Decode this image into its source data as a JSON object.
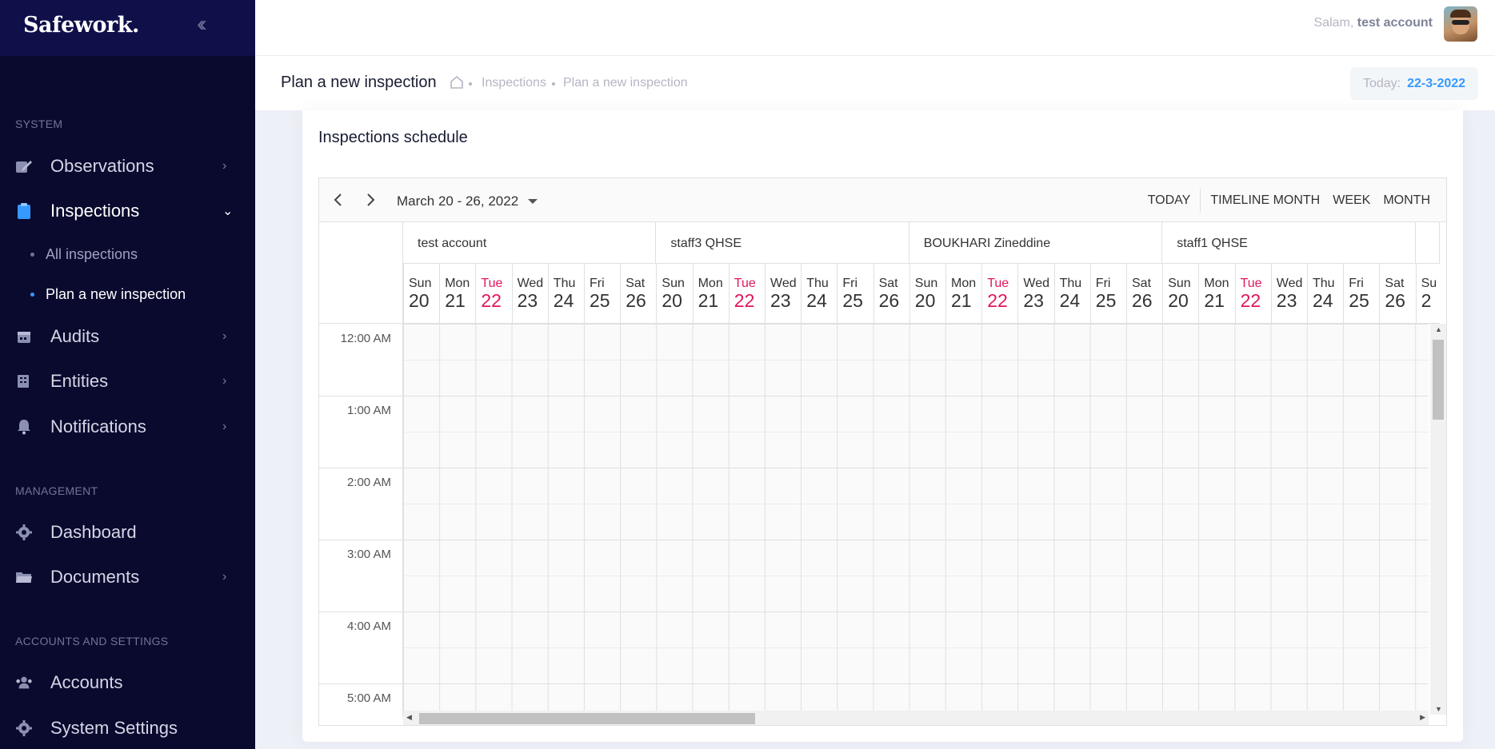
{
  "app": {
    "brand": "Safework.",
    "collapse_icon": "double-chevron-left-icon"
  },
  "sidebar": {
    "sections": [
      {
        "title": "SYSTEM"
      },
      {
        "title": "MANAGEMENT"
      },
      {
        "title": "ACCOUNTS AND SETTINGS"
      }
    ],
    "items": [
      {
        "label": "Observations",
        "icon": "edit-icon"
      },
      {
        "label": "Inspections",
        "icon": "clipboard-icon"
      },
      {
        "label": "Audits",
        "icon": "calendar-icon"
      },
      {
        "label": "Entities",
        "icon": "building-icon"
      },
      {
        "label": "Notifications",
        "icon": "bell-icon"
      },
      {
        "label": "Dashboard",
        "icon": "gear-icon"
      },
      {
        "label": "Documents",
        "icon": "folder-icon"
      },
      {
        "label": "Accounts",
        "icon": "users-icon"
      },
      {
        "label": "System Settings",
        "icon": "gear-icon"
      }
    ],
    "subitems": [
      {
        "label": "All inspections"
      },
      {
        "label": "Plan a new inspection"
      }
    ],
    "accent_color": "#3699ff"
  },
  "header": {
    "greeting": "Salam,",
    "user": "test account"
  },
  "subheader": {
    "title": "Plan a new inspection",
    "breadcrumb": [
      "Inspections",
      "Plan a new inspection"
    ],
    "today_label": "Today:",
    "today_value": "22-3-2022"
  },
  "card": {
    "title": "Inspections schedule"
  },
  "scheduler": {
    "date_range": "March 20 - 26, 2022",
    "views": [
      "TODAY",
      "TIMELINE MONTH",
      "WEEK",
      "MONTH"
    ],
    "resources": [
      "test account",
      "staff3 QHSE",
      "BOUKHARI Zineddine",
      "staff1 QHSE"
    ],
    "days": [
      {
        "name": "Sun",
        "num": "20"
      },
      {
        "name": "Mon",
        "num": "21"
      },
      {
        "name": "Tue",
        "num": "22"
      },
      {
        "name": "Wed",
        "num": "23"
      },
      {
        "name": "Thu",
        "num": "24"
      },
      {
        "name": "Fri",
        "num": "25"
      },
      {
        "name": "Sat",
        "num": "26"
      }
    ],
    "overflow_day": {
      "name": "Su",
      "num": "2"
    },
    "current_day_color": "#e3165b",
    "times": [
      "12:00 AM",
      "1:00 AM",
      "2:00 AM",
      "3:00 AM",
      "4:00 AM",
      "5:00 AM"
    ]
  }
}
